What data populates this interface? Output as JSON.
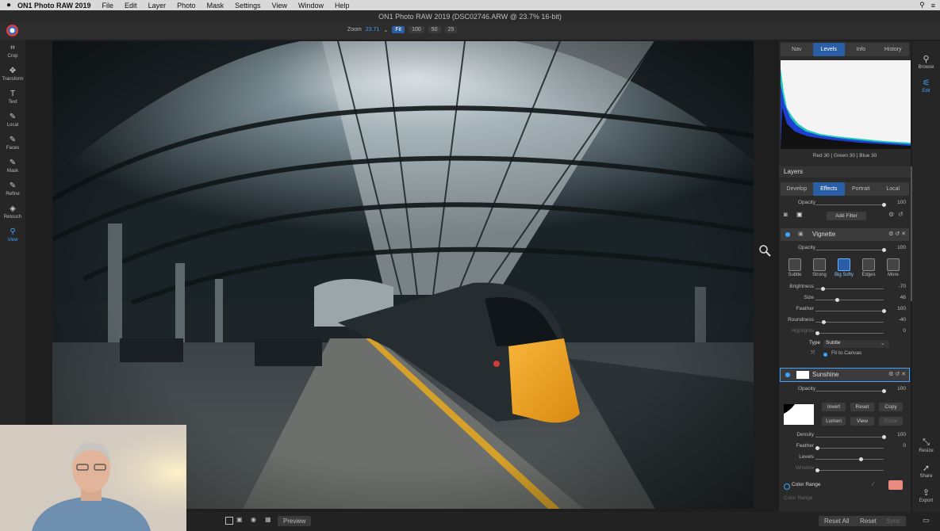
{
  "menubar": {
    "app_name": "ON1 Photo RAW 2019",
    "items": [
      "File",
      "Edit",
      "Layer",
      "Photo",
      "Mask",
      "Settings",
      "View",
      "Window",
      "Help"
    ]
  },
  "window": {
    "title": "ON1 Photo RAW 2019 (DSC02746.ARW @ 23.7% 16-bit)"
  },
  "toolbar": {
    "zoom_label": "Zoom",
    "zoom_value": "23.71",
    "zoom_options": [
      "Fit",
      "100",
      "50",
      "25"
    ],
    "zoom_selected": "Fit"
  },
  "left_tools": [
    {
      "label": "Crop",
      "icon": "crop-icon",
      "glyph": "⌗"
    },
    {
      "label": "Transform",
      "icon": "transform-icon",
      "glyph": "✥"
    },
    {
      "label": "Text",
      "icon": "text-icon",
      "glyph": "T"
    },
    {
      "label": "Local",
      "icon": "brush-icon",
      "glyph": "✎"
    },
    {
      "label": "Faces",
      "icon": "faces-icon",
      "glyph": "✎"
    },
    {
      "label": "Mask",
      "icon": "mask-brush-icon",
      "glyph": "✎"
    },
    {
      "label": "Refine",
      "icon": "refine-icon",
      "glyph": "✎"
    },
    {
      "label": "Retouch",
      "icon": "retouch-icon",
      "glyph": "◈"
    },
    {
      "label": "View",
      "icon": "view-zoom-icon",
      "glyph": "⚲"
    }
  ],
  "left_tool_active": "View",
  "panel": {
    "top_tabs": [
      "Nav",
      "Levels",
      "Info",
      "History"
    ],
    "top_tab_selected": "Levels",
    "rgb_readout": "Red  30  |  Green  30  |  Blue  30",
    "layers_title": "Layers",
    "module_tabs": [
      "Develop",
      "Effects",
      "Portrait",
      "Local"
    ],
    "module_tab_selected": "Effects",
    "opacity_label": "Opacity",
    "opacity_value": "100",
    "add_filter_label": "Add Filter",
    "vignette": {
      "title": "Vignette",
      "opacity_label": "Opacity",
      "opacity_value": "100",
      "presets": [
        "Subtle",
        "Strong",
        "Big Softy",
        "Edges",
        "More"
      ],
      "preset_selected": "Big Softy",
      "sliders": [
        {
          "label": "Brightness",
          "value": "-70",
          "pos": 0.08
        },
        {
          "label": "Size",
          "value": "46",
          "pos": 0.3
        },
        {
          "label": "Feather",
          "value": "100",
          "pos": 1.0
        },
        {
          "label": "Roundness",
          "value": "-40",
          "pos": 0.1
        },
        {
          "label": "Highlights",
          "value": "0",
          "pos": 0.0
        }
      ],
      "type_label": "Type",
      "type_value": "Subtle",
      "fit_to_canvas_label": "Fit to Canvas"
    },
    "sunshine": {
      "title": "Sunshine",
      "opacity_label": "Opacity",
      "opacity_value": "100",
      "mask_buttons": [
        "Invert",
        "Reset",
        "Copy",
        "Lumen",
        "View",
        "Paste"
      ],
      "sliders": [
        {
          "label": "Density",
          "value": "100",
          "pos": 1.0
        },
        {
          "label": "Feather",
          "value": "0",
          "pos": 0.0
        },
        {
          "label": "Levels",
          "value": "",
          "pos": 0.65
        },
        {
          "label": "Window",
          "value": "",
          "pos": 0.0
        }
      ],
      "color_range_label": "Color Range",
      "color_range_swatch": "#e88a80",
      "color_range_sub": "Color Range"
    }
  },
  "far_right": {
    "top": [
      {
        "label": "Browse",
        "icon": "browse-icon"
      },
      {
        "label": "Edit",
        "icon": "edit-sliders-icon"
      }
    ],
    "bottom": [
      {
        "label": "Resize",
        "icon": "resize-icon"
      },
      {
        "label": "Share",
        "icon": "share-icon"
      },
      {
        "label": "Export",
        "icon": "export-icon"
      }
    ],
    "active": "Edit"
  },
  "bottombar": {
    "preview_label": "Preview",
    "reset_all_label": "Reset All",
    "reset_label": "Reset",
    "sync_label": "Sync"
  },
  "colors": {
    "accent": "#2b5fa5",
    "accent_text": "#3ea3ff",
    "panel": "#2a2a2a"
  }
}
